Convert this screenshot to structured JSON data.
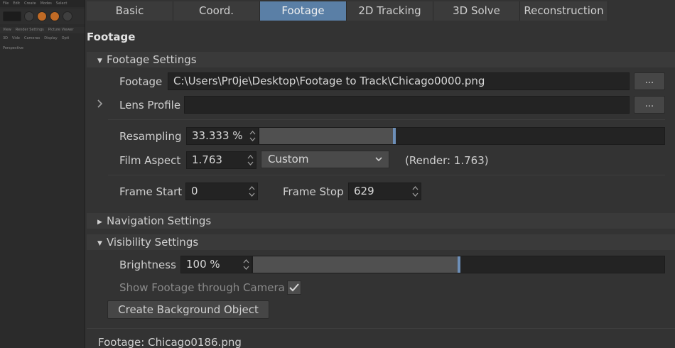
{
  "left_pane": {
    "menu": [
      "File",
      "Edit",
      "Create",
      "Modes",
      "Select"
    ],
    "sub1": [
      "View",
      "Render Settings",
      "Picture Viewer"
    ],
    "sub2": [
      "3D",
      "Vide",
      "Cameras",
      "Display",
      "Opti"
    ],
    "sub3": "Perspective"
  },
  "tabs": [
    "Basic",
    "Coord.",
    "Footage",
    "2D Tracking",
    "3D Solve",
    "Reconstruction"
  ],
  "active_tab": "Footage",
  "panel_title": "Footage",
  "footage_settings": {
    "header": "Footage Settings",
    "footage_label": "Footage",
    "footage_path": "C:\\Users\\Pr0je\\Desktop\\Footage to Track\\Chicago0000.png",
    "browse_label": "...",
    "lens_profile_label": "Lens Profile",
    "lens_profile_value": "",
    "resampling_label": "Resampling",
    "resampling_value": "33.333 %",
    "resampling_fraction": 0.3333,
    "film_aspect_label": "Film Aspect",
    "film_aspect_value": "1.763",
    "film_aspect_preset": "Custom",
    "render_aspect": "(Render: 1.763)",
    "frame_start_label": "Frame Start",
    "frame_start_value": "0",
    "frame_stop_label": "Frame Stop",
    "frame_stop_value": "629"
  },
  "navigation_settings": {
    "header": "Navigation Settings"
  },
  "visibility_settings": {
    "header": "Visibility Settings",
    "brightness_label": "Brightness",
    "brightness_value": "100 %",
    "brightness_fraction": 0.5,
    "show_footage_label": "Show Footage through Camera",
    "show_footage_checked": true,
    "create_bg_label": "Create Background Object"
  },
  "footer": "Footage: Chicago0186.png",
  "colors": {
    "accent": "#5a7fa6",
    "handle": "#6d8fb8",
    "background": "#333333"
  }
}
